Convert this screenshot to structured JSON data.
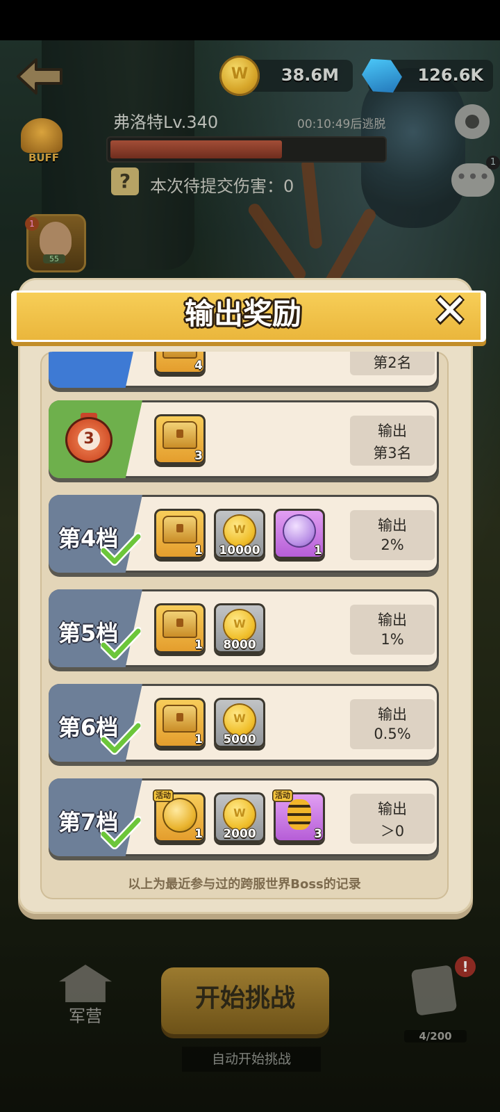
{
  "hud": {
    "coins": "38.6M",
    "gems": "126.6K",
    "boss_name": "弗洛特Lv.340",
    "escape_timer": "00:10:49后逃脱",
    "hp_percent": 63,
    "help_glyph": "?",
    "pending_damage": "本次待提交伤害：0",
    "buff_label": "BUFF",
    "chat_badge": "1",
    "hero_level": "55",
    "hero_badge": "1"
  },
  "modal": {
    "title": "输出奖励",
    "close_glyph": "✕",
    "partial_row": {
      "item_qty": "4",
      "requirement": "第2名"
    },
    "rows": [
      {
        "tier": "3",
        "items": [
          {
            "icon": "chest-icon",
            "qty": "3"
          }
        ],
        "req_line1": "输出",
        "req_line2": "第3名"
      },
      {
        "tier": "第4档",
        "items": [
          {
            "icon": "chest-icon",
            "qty": "1"
          },
          {
            "icon": "coin-icon",
            "qty": "10000"
          },
          {
            "icon": "purple-orb-icon",
            "qty": "1"
          }
        ],
        "req_line1": "输出",
        "req_line2": "2%"
      },
      {
        "tier": "第5档",
        "items": [
          {
            "icon": "chest-icon",
            "qty": "1"
          },
          {
            "icon": "coin-icon",
            "qty": "8000"
          }
        ],
        "req_line1": "输出",
        "req_line2": "1%"
      },
      {
        "tier": "第6档",
        "items": [
          {
            "icon": "chest-icon",
            "qty": "1"
          },
          {
            "icon": "coin-icon",
            "qty": "5000"
          }
        ],
        "req_line1": "输出",
        "req_line2": "0.5%"
      },
      {
        "tier": "第7档",
        "items": [
          {
            "icon": "event-medal-icon",
            "qty": "1",
            "tag": "活动"
          },
          {
            "icon": "coin-icon",
            "qty": "2000"
          },
          {
            "icon": "bee-icon",
            "qty": "3",
            "tag": "活动"
          }
        ],
        "req_line1": "输出",
        "req_line2": "＞0"
      }
    ],
    "footnote": "以上为最近参与过的跨服世界Boss的记录"
  },
  "bottom": {
    "barracks": "军营",
    "start": "开始挑战",
    "auto_start": "自动开始挑战",
    "cards_count": "4/200",
    "cards_alert": "!"
  }
}
